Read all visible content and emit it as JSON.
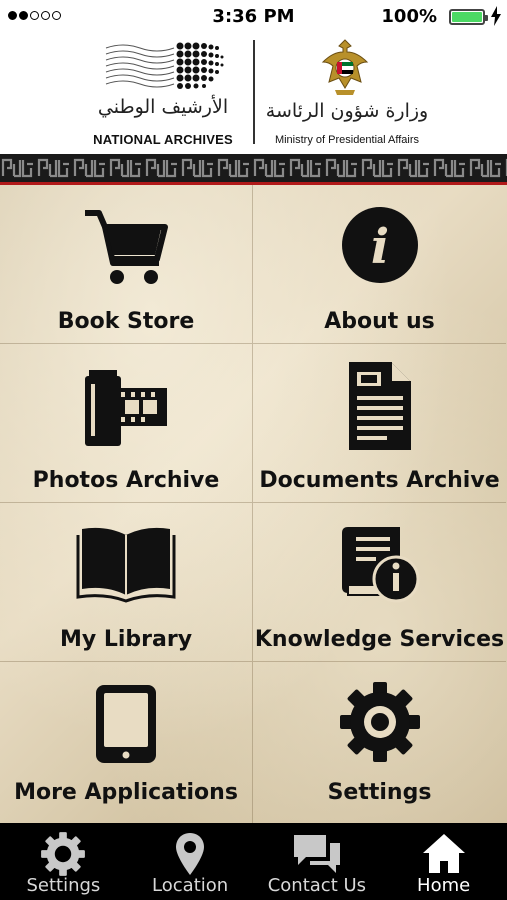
{
  "status_bar": {
    "time": "3:36 PM",
    "battery": "100%",
    "signal_bars_filled": 2,
    "signal_bars_total": 5
  },
  "header": {
    "national_archives_ar": "الأرشيف الوطني",
    "national_archives_en": "NATIONAL ARCHIVES",
    "ministry_ar": "وزارة شؤون الرئاسة",
    "ministry_en": "Ministry of Presidential Affairs"
  },
  "menu": {
    "book_store": "Book Store",
    "about_us": "About us",
    "photos_archive": "Photos Archive",
    "documents_archive": "Documents Archive",
    "my_library": "My Library",
    "knowledge_services": "Knowledge Services",
    "more_applications": "More Applications",
    "settings": "Settings"
  },
  "tabbar": {
    "settings": "Settings",
    "location": "Location",
    "contact_us": "Contact Us",
    "home": "Home",
    "active": "Home"
  },
  "colors": {
    "battery": "#4cd964",
    "accent_strip": "#b11a1a",
    "tabbar_bg": "#000000"
  }
}
